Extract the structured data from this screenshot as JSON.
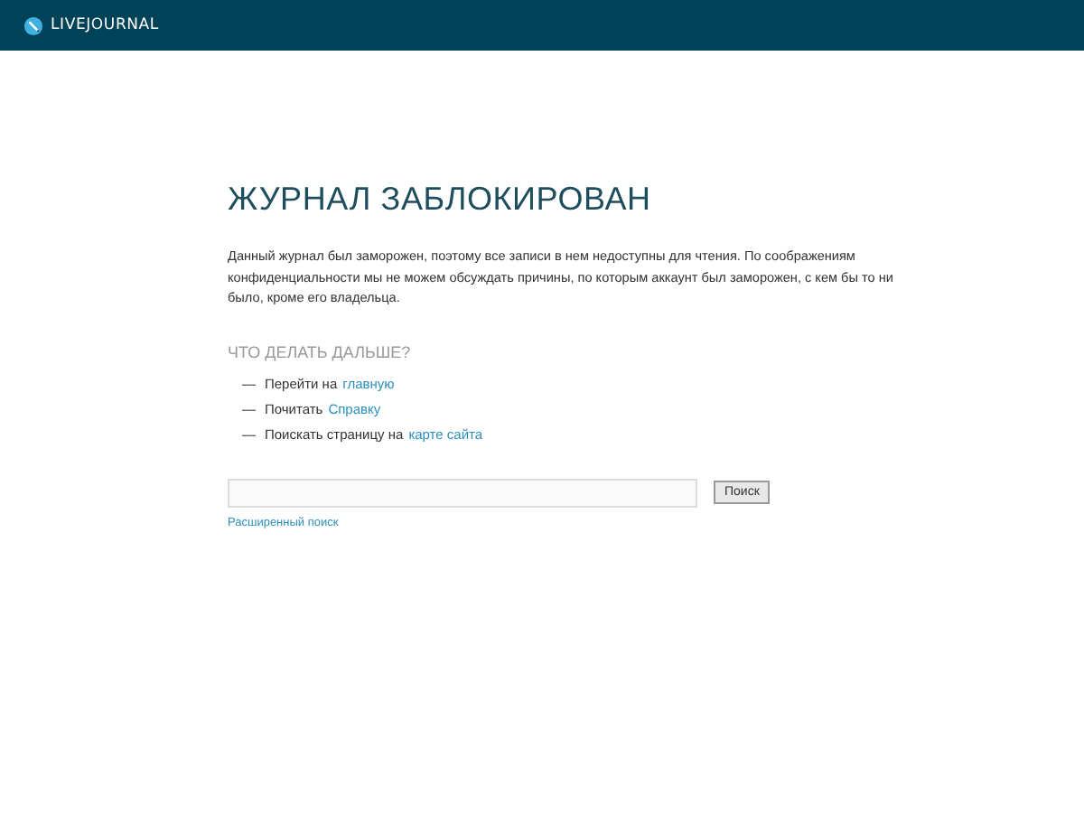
{
  "header": {
    "logo_text": "LIVEJOURNAL"
  },
  "title": "ЖУРНАЛ ЗАБЛОКИРОВАН",
  "message": "Данный журнал был заморожен, поэтому все записи в нем недоступны для чтения. По соображениям конфиденциальности мы не можем обсуждать причины, по которым аккаунт был заморожен, с кем бы то ни было, кроме его владельца.",
  "next_steps": {
    "heading": "ЧТО ДЕЛАТЬ ДАЛЬШЕ?",
    "items": [
      {
        "bullet": "—",
        "text": "Перейти на",
        "link": "главную"
      },
      {
        "bullet": "—",
        "text": "Почитать",
        "link": "Справку"
      },
      {
        "bullet": "—",
        "text": "Поискать страницу на",
        "link": "карте сайта"
      }
    ]
  },
  "search": {
    "button": "Поиск",
    "advanced_link": "Расширенный поиск"
  }
}
